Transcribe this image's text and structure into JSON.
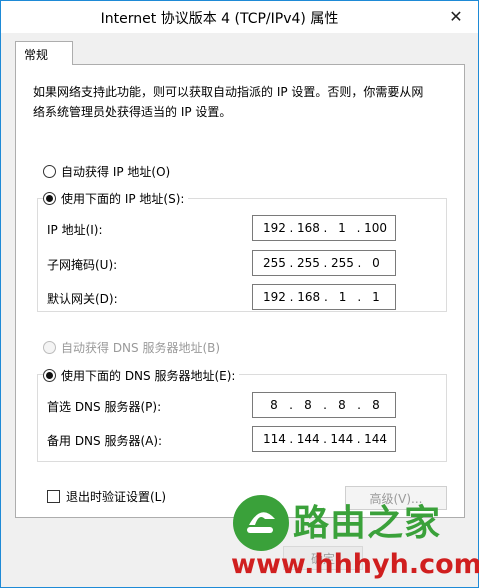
{
  "window": {
    "title": "Internet 协议版本 4 (TCP/IPv4) 属性",
    "close_glyph": "✕"
  },
  "tab": {
    "label": "常规"
  },
  "description": {
    "line1": "如果网络支持此功能，则可以获取自动指派的 IP 设置。否则，你需要从网",
    "line2": "络系统管理员处获得适当的 IP 设置。"
  },
  "ip_mode": {
    "auto_label": "自动获得 IP 地址(O)",
    "manual_label": "使用下面的 IP 地址(S):",
    "selected": "manual"
  },
  "ip_fields": {
    "ip_address": {
      "label": "IP 地址(I):",
      "octets": [
        "192",
        "168",
        "1",
        "100"
      ]
    },
    "subnet_mask": {
      "label": "子网掩码(U):",
      "octets": [
        "255",
        "255",
        "255",
        "0"
      ]
    },
    "gateway": {
      "label": "默认网关(D):",
      "octets": [
        "192",
        "168",
        "1",
        "1"
      ]
    }
  },
  "dns_mode": {
    "auto_label": "自动获得 DNS 服务器地址(B)",
    "manual_label": "使用下面的 DNS 服务器地址(E):",
    "selected": "manual",
    "auto_disabled": true
  },
  "dns_fields": {
    "preferred": {
      "label": "首选 DNS 服务器(P):",
      "octets": [
        "8",
        "8",
        "8",
        "8"
      ]
    },
    "alternate": {
      "label": "备用 DNS 服务器(A):",
      "octets": [
        "114",
        "144",
        "144",
        "144"
      ]
    }
  },
  "validate_on_exit": {
    "label": "退出时验证设置(L)",
    "checked": false
  },
  "buttons": {
    "advanced": "高级(V)...",
    "ok": "确定"
  },
  "watermark": {
    "brand": "路由之家",
    "url": "www.hhhyh.com"
  },
  "colors": {
    "window_border": "#1e8ad6",
    "watermark_green": "#3aa13a",
    "watermark_red": "#d01f1f"
  }
}
